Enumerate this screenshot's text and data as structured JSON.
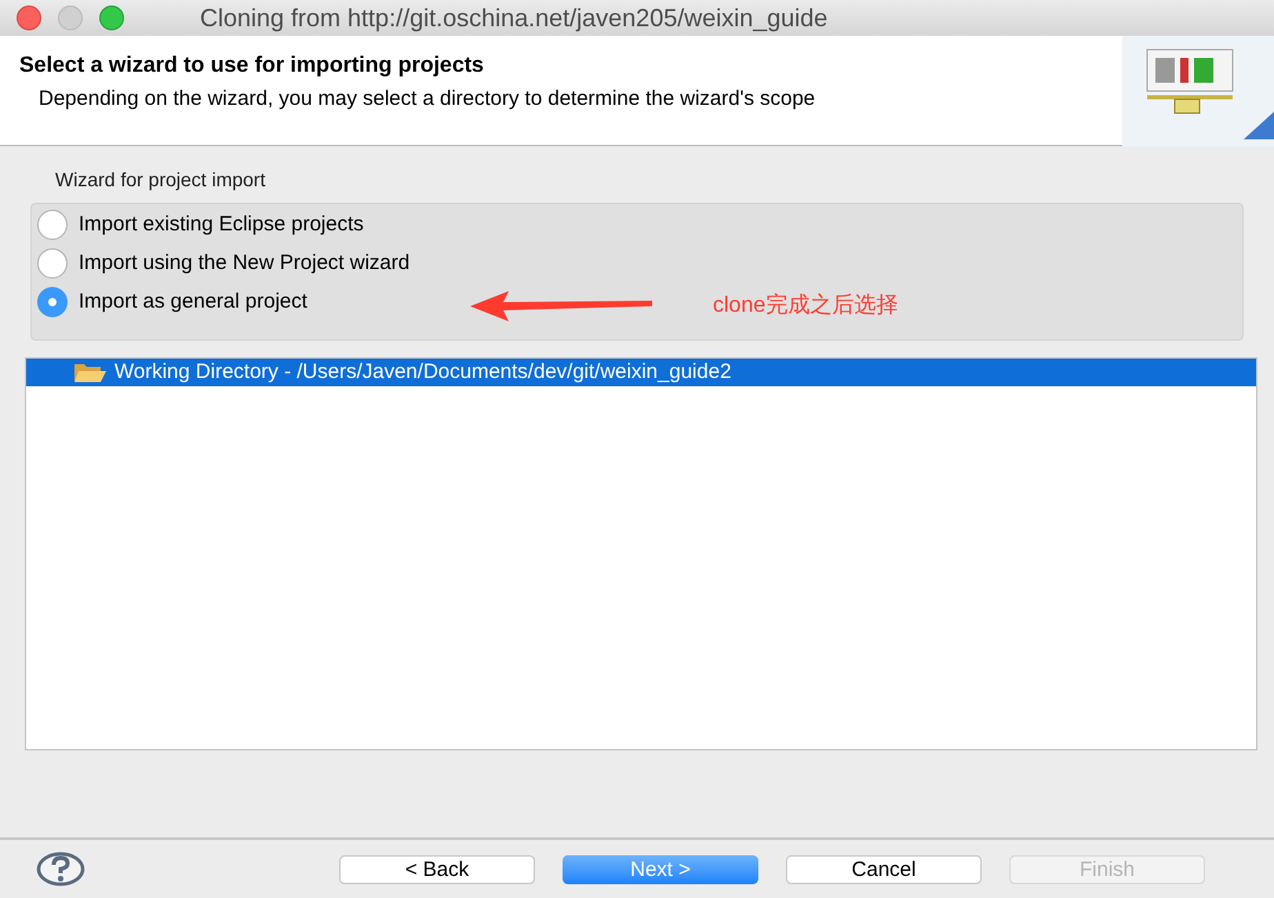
{
  "window": {
    "title": "Cloning from http://git.oschina.net/javen205/weixin_guide"
  },
  "header": {
    "title": "Select a wizard to use for importing projects",
    "description": "Depending on the wizard, you may select a directory to determine the wizard's scope"
  },
  "wizard_group": {
    "label": "Wizard for project import",
    "options": [
      {
        "label": "Import existing Eclipse projects",
        "selected": false
      },
      {
        "label": "Import using the New Project wizard",
        "selected": false
      },
      {
        "label": "Import as general project",
        "selected": true
      }
    ]
  },
  "annotation": {
    "text": "clone完成之后选择",
    "color": "#ff3b30"
  },
  "tree": {
    "items": [
      {
        "label": "Working Directory - /Users/Javen/Documents/dev/git/weixin_guide2",
        "selected": true
      }
    ]
  },
  "buttons": [
    {
      "label": "< Back",
      "primary": false,
      "disabled": false
    },
    {
      "label": "Next >",
      "primary": true,
      "disabled": false
    },
    {
      "label": "Cancel",
      "primary": false,
      "disabled": false
    },
    {
      "label": "Finish",
      "primary": false,
      "disabled": true
    }
  ]
}
